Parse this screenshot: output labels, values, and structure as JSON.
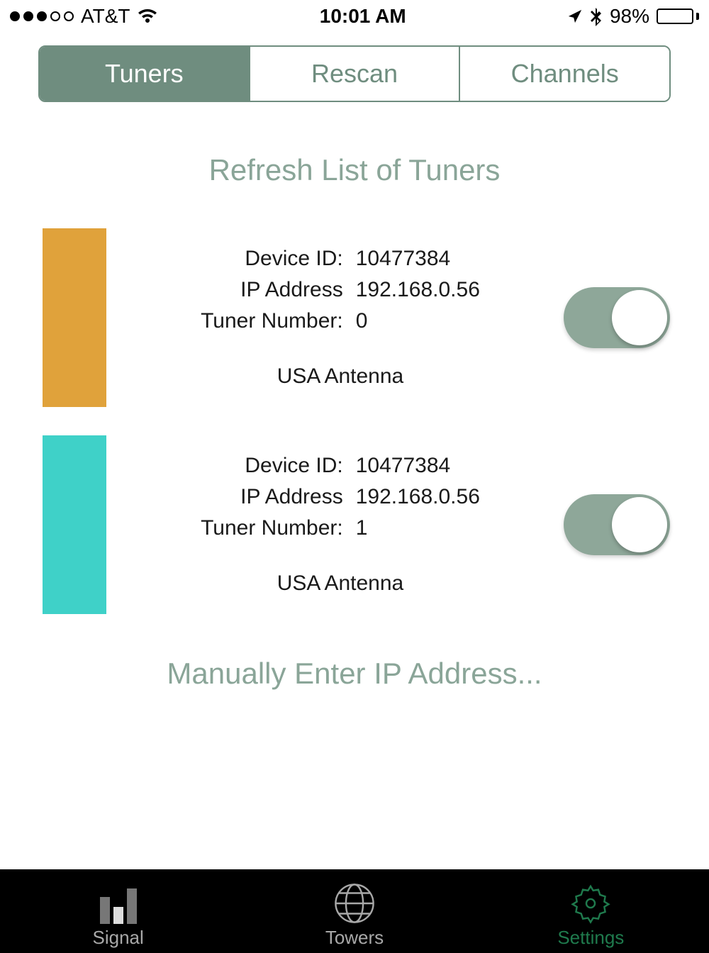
{
  "status": {
    "carrier": "AT&T",
    "time": "10:01 AM",
    "battery_pct": "98%"
  },
  "segmented": {
    "tuners": "Tuners",
    "rescan": "Rescan",
    "channels": "Channels"
  },
  "refresh_label": "Refresh List of Tuners",
  "labels": {
    "device_id": "Device ID:",
    "ip_address": "IP Address",
    "tuner_number": "Tuner Number:"
  },
  "tuners": [
    {
      "device_id": "10477384",
      "ip": "192.168.0.56",
      "tuner_number": "0",
      "antenna": "USA Antenna",
      "enabled": true,
      "color": "#e0a23b"
    },
    {
      "device_id": "10477384",
      "ip": "192.168.0.56",
      "tuner_number": "1",
      "antenna": "USA Antenna",
      "enabled": true,
      "color": "#3fd1c8"
    }
  ],
  "manual_label": "Manually Enter IP Address...",
  "tabs": {
    "signal": "Signal",
    "towers": "Towers",
    "settings": "Settings"
  }
}
